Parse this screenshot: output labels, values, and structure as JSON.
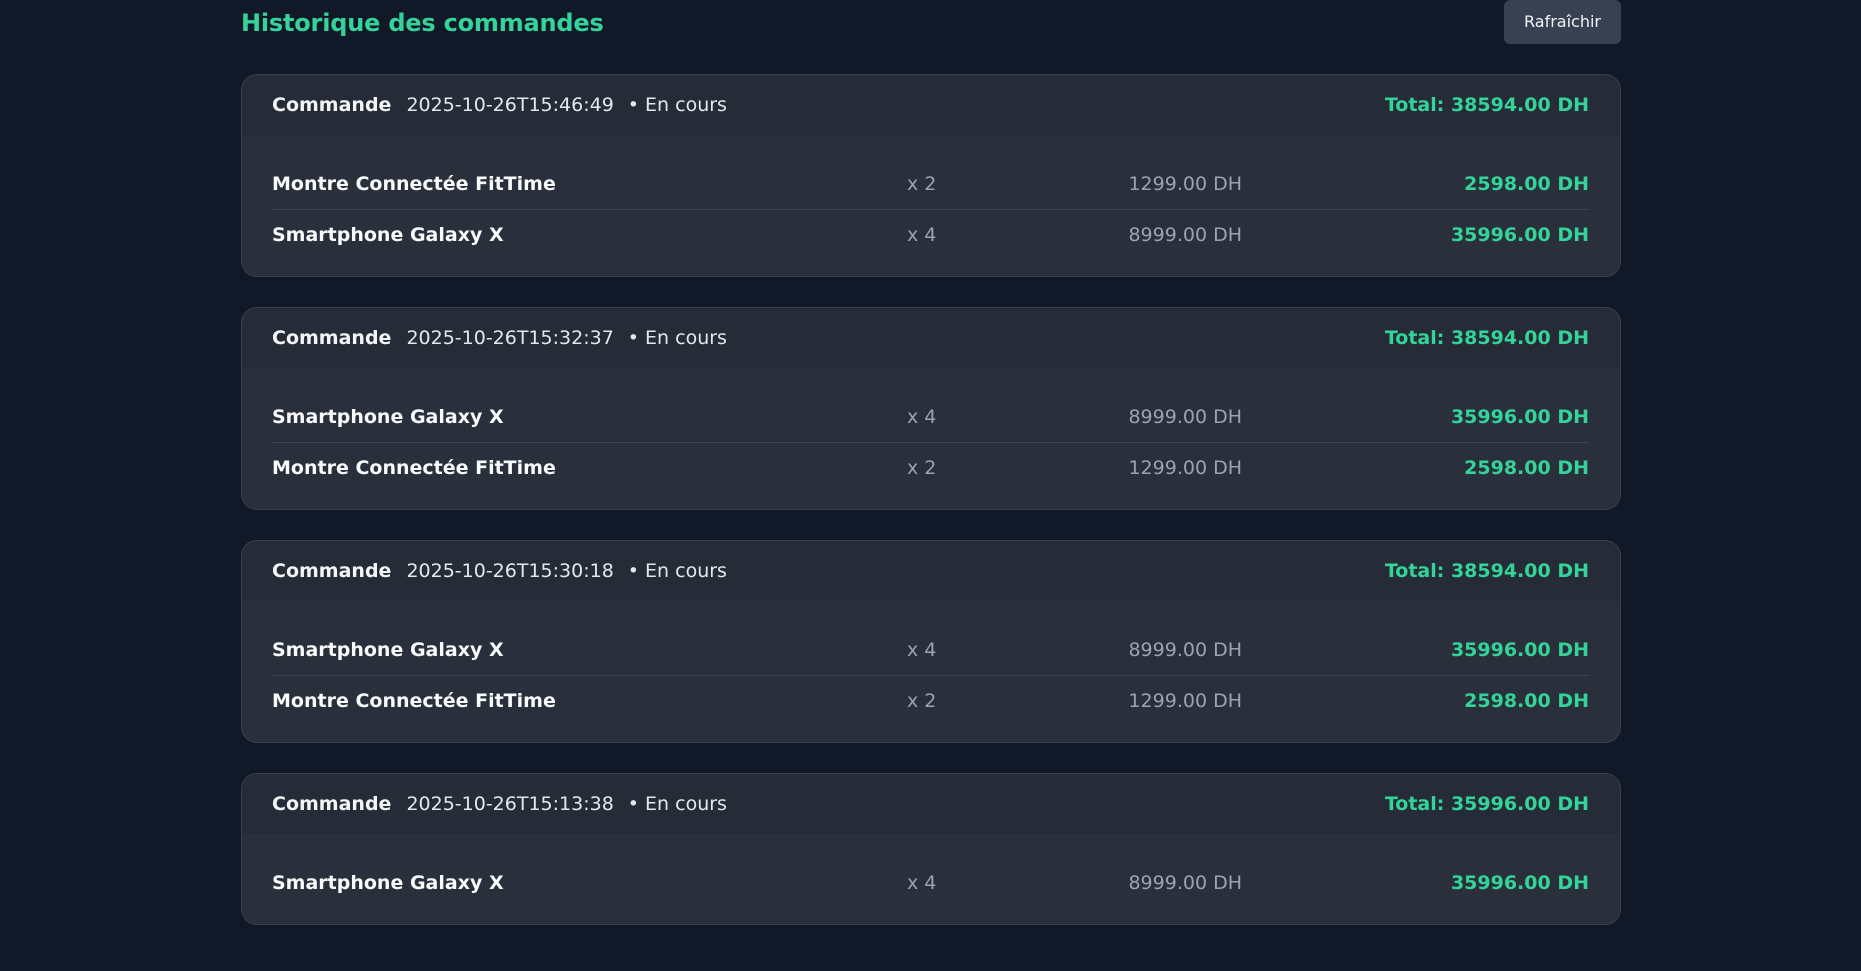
{
  "header": {
    "title": "Historique des commandes",
    "refresh_label": "Rafraîchir"
  },
  "colors": {
    "background": "#111827",
    "card": "#272e3a",
    "accent": "#34d399",
    "muted": "#9ca3af",
    "button": "#374151"
  },
  "orders": [
    {
      "label": "Commande",
      "date": "2025-10-26T15:46:49",
      "status": "• En cours",
      "total": "Total: 38594.00 DH",
      "items": [
        {
          "name": "Montre Connectée FitTime",
          "qty": "x 2",
          "unit_price": "1299.00 DH",
          "line_total": "2598.00 DH"
        },
        {
          "name": "Smartphone Galaxy X",
          "qty": "x 4",
          "unit_price": "8999.00 DH",
          "line_total": "35996.00 DH"
        }
      ]
    },
    {
      "label": "Commande",
      "date": "2025-10-26T15:32:37",
      "status": "• En cours",
      "total": "Total: 38594.00 DH",
      "items": [
        {
          "name": "Smartphone Galaxy X",
          "qty": "x 4",
          "unit_price": "8999.00 DH",
          "line_total": "35996.00 DH"
        },
        {
          "name": "Montre Connectée FitTime",
          "qty": "x 2",
          "unit_price": "1299.00 DH",
          "line_total": "2598.00 DH"
        }
      ]
    },
    {
      "label": "Commande",
      "date": "2025-10-26T15:30:18",
      "status": "• En cours",
      "total": "Total: 38594.00 DH",
      "items": [
        {
          "name": "Smartphone Galaxy X",
          "qty": "x 4",
          "unit_price": "8999.00 DH",
          "line_total": "35996.00 DH"
        },
        {
          "name": "Montre Connectée FitTime",
          "qty": "x 2",
          "unit_price": "1299.00 DH",
          "line_total": "2598.00 DH"
        }
      ]
    },
    {
      "label": "Commande",
      "date": "2025-10-26T15:13:38",
      "status": "• En cours",
      "total": "Total: 35996.00 DH",
      "items": [
        {
          "name": "Smartphone Galaxy X",
          "qty": "x 4",
          "unit_price": "8999.00 DH",
          "line_total": "35996.00 DH"
        }
      ]
    }
  ]
}
